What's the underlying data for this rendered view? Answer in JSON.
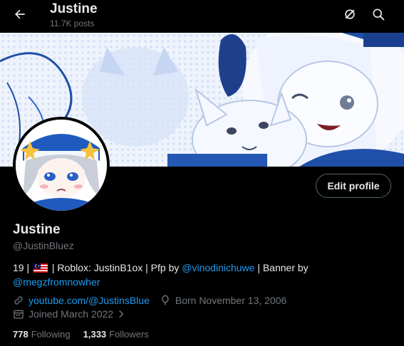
{
  "header": {
    "title": "Justine",
    "posts_count": "11.7K posts",
    "back_icon": "arrow-left-icon",
    "grok_icon": "grok-icon",
    "search_icon": "search-icon"
  },
  "banner": {
    "description_icon": "banner-image"
  },
  "profile": {
    "name": "Justine",
    "handle": "@JustinBluez",
    "edit_button": "Edit profile",
    "bio": {
      "part1": "19 |",
      "part2": "| Roblox: JustinB1ox | Pfp by",
      "pfp_link": "@vinodinichuwe",
      "part3": "| Banner by",
      "banner_link": "@megzfromnowher"
    },
    "website": "youtube.com/@JustinsBlue",
    "birthday": "Born November 13, 2006",
    "joined": "Joined March 2022",
    "following_count": "778",
    "following_label": "Following",
    "followers_count": "1,333",
    "followers_label": "Followers"
  },
  "colors": {
    "accent": "#1d9bf0",
    "text": "#e7e9ea",
    "muted": "#71767b",
    "background": "#000000"
  }
}
